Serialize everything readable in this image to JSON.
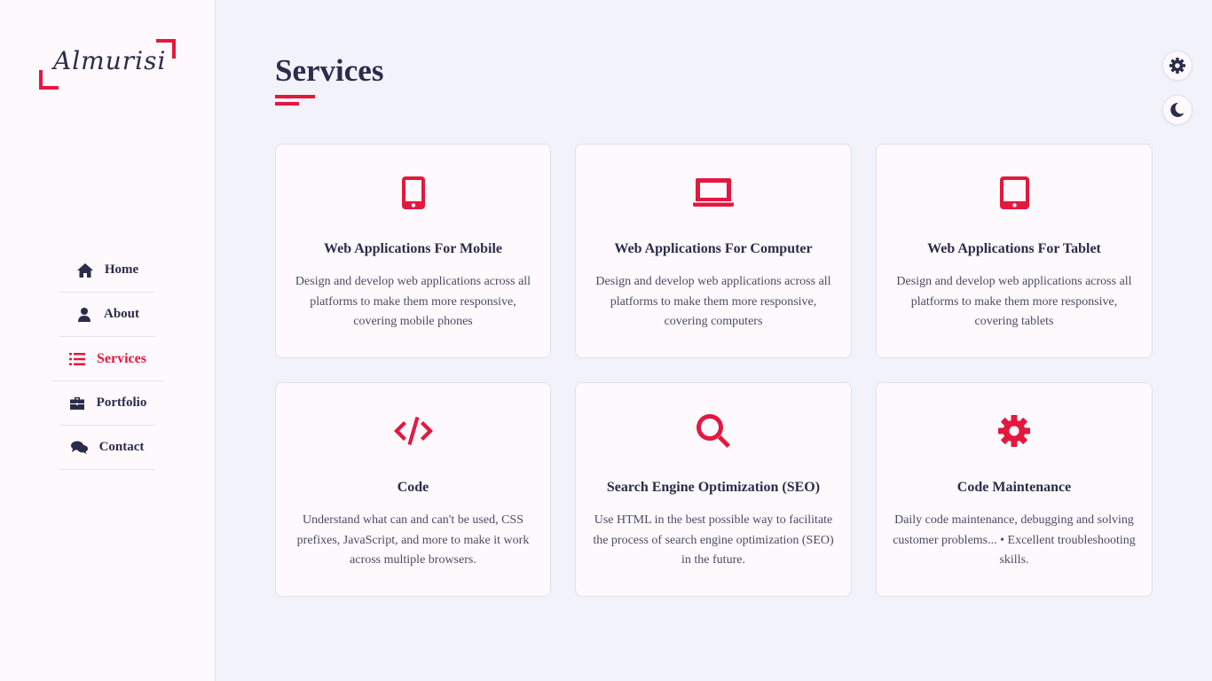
{
  "brand": {
    "logo_text": "Almurisi",
    "accent": "#e3183f"
  },
  "nav": [
    {
      "label": "Home",
      "icon": "home-icon",
      "active": false
    },
    {
      "label": "About",
      "icon": "user-icon",
      "active": false
    },
    {
      "label": "Services",
      "icon": "list-icon",
      "active": true
    },
    {
      "label": "Portfolio",
      "icon": "briefcase-icon",
      "active": false
    },
    {
      "label": "Contact",
      "icon": "comments-icon",
      "active": false
    }
  ],
  "page": {
    "title": "Services"
  },
  "services": [
    {
      "icon": "mobile-icon",
      "title": "Web Applications For Mobile",
      "desc": "Design and develop web applications across all platforms to make them more responsive, covering mobile phones"
    },
    {
      "icon": "laptop-icon",
      "title": "Web Applications For Computer",
      "desc": "Design and develop web applications across all platforms to make them more responsive, covering computers"
    },
    {
      "icon": "tablet-icon",
      "title": "Web Applications For Tablet",
      "desc": "Design and develop web applications across all platforms to make them more responsive, covering tablets"
    },
    {
      "icon": "code-icon",
      "title": "Code",
      "desc": "Understand what can and can't be used, CSS prefixes, JavaScript, and more to make it work across multiple browsers."
    },
    {
      "icon": "search-icon",
      "title": "Search Engine Optimization (SEO)",
      "desc": "Use HTML in the best possible way to facilitate the process of search engine optimization (SEO) in the future."
    },
    {
      "icon": "gear-icon",
      "title": "Code Maintenance",
      "desc": "Daily code maintenance, debugging and solving customer problems... • Excellent troubleshooting skills."
    }
  ],
  "controls": {
    "settings_icon": "gear-icon",
    "theme_icon": "moon-icon"
  }
}
